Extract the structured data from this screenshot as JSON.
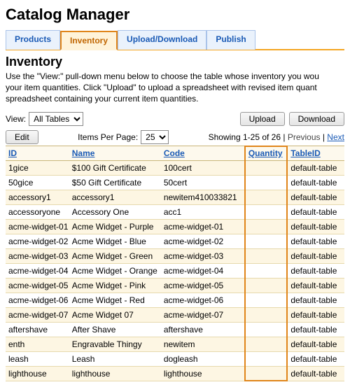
{
  "app_title": "Catalog Manager",
  "tabs": {
    "products": "Products",
    "inventory": "Inventory",
    "upload": "Upload/Download",
    "publish": "Publish"
  },
  "section_title": "Inventory",
  "intro_text": "Use the \"View:\" pull-down menu below to choose the table whose inventory you wou\nyour item quantities. Click \"Upload\" to upload a spreadsheet with revised item quant\nspreadsheet containing your current item quantities.",
  "toolbar": {
    "view_label": "View:",
    "view_value": "All Tables",
    "upload_label": "Upload",
    "download_label": "Download",
    "edit_label": "Edit",
    "items_per_page_label": "Items Per Page:",
    "items_per_page_value": "25",
    "showing_text": "Showing 1-25 of 26 | ",
    "previous_label": "Previous",
    "sep": " | ",
    "next_label": "Next"
  },
  "columns": {
    "id": "ID",
    "name": "Name",
    "code": "Code",
    "quantity": "Quantity",
    "tableid": "TableID"
  },
  "rows": [
    {
      "id": "1gice",
      "name": "$100 Gift Certificate",
      "code": "100cert",
      "qty": "",
      "tid": "default-table"
    },
    {
      "id": "50gice",
      "name": "$50 Gift Certificate",
      "code": "50cert",
      "qty": "",
      "tid": "default-table"
    },
    {
      "id": "accessory1",
      "name": "accessory1",
      "code": "newitem410033821",
      "qty": "",
      "tid": "default-table"
    },
    {
      "id": "accessoryone",
      "name": "Accessory One",
      "code": "acc1",
      "qty": "",
      "tid": "default-table"
    },
    {
      "id": "acme-widget-01",
      "name": "Acme Widget - Purple",
      "code": "acme-widget-01",
      "qty": "",
      "tid": "default-table"
    },
    {
      "id": "acme-widget-02",
      "name": "Acme Widget - Blue",
      "code": "acme-widget-02",
      "qty": "",
      "tid": "default-table"
    },
    {
      "id": "acme-widget-03",
      "name": "Acme Widget - Green",
      "code": "acme-widget-03",
      "qty": "",
      "tid": "default-table"
    },
    {
      "id": "acme-widget-04",
      "name": "Acme Widget - Orange",
      "code": "acme-widget-04",
      "qty": "",
      "tid": "default-table"
    },
    {
      "id": "acme-widget-05",
      "name": "Acme Widget - Pink",
      "code": "acme-widget-05",
      "qty": "",
      "tid": "default-table"
    },
    {
      "id": "acme-widget-06",
      "name": "Acme Widget - Red",
      "code": "acme-widget-06",
      "qty": "",
      "tid": "default-table"
    },
    {
      "id": "acme-widget-07",
      "name": "Acme Widget 07",
      "code": "acme-widget-07",
      "qty": "",
      "tid": "default-table"
    },
    {
      "id": "aftershave",
      "name": "After Shave",
      "code": "aftershave",
      "qty": "",
      "tid": "default-table"
    },
    {
      "id": "enth",
      "name": "Engravable Thingy",
      "code": "newitem",
      "qty": "",
      "tid": "default-table"
    },
    {
      "id": "leash",
      "name": "Leash",
      "code": "dogleash",
      "qty": "",
      "tid": "default-table"
    },
    {
      "id": "lighthouse",
      "name": "lighthouse",
      "code": "lighthouse",
      "qty": "",
      "tid": "default-table"
    }
  ]
}
